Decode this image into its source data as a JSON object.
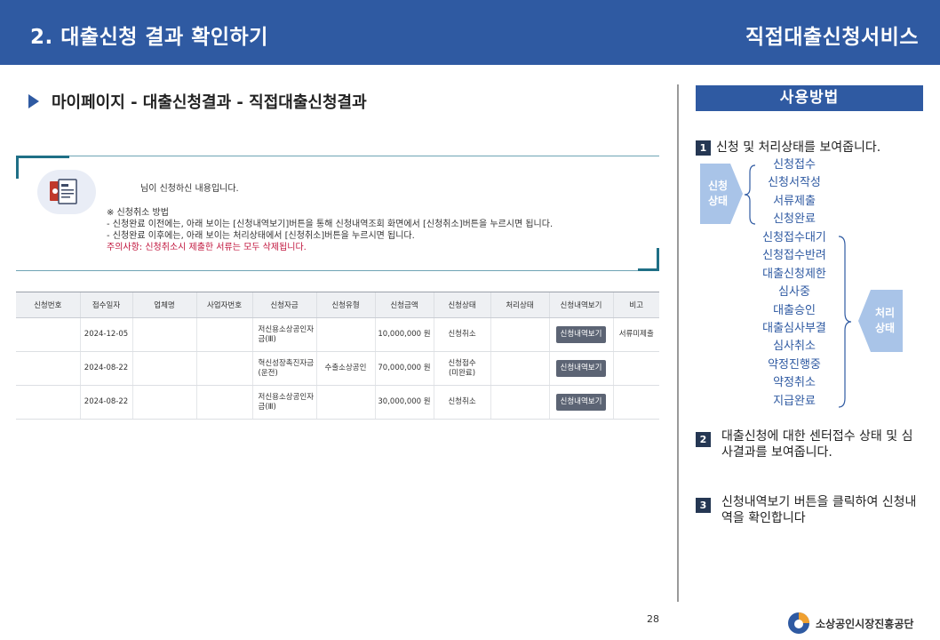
{
  "header": {
    "title_left": "2. 대출신청 결과 확인하기",
    "title_right": "직접대출신청서비스"
  },
  "breadcrumb": "마이페이지 - 대출신청결과 - 직접대출신청결과",
  "notice": {
    "greeting": "님이 신청하신 내용입니다.",
    "lines": [
      "※ 신청취소 방법",
      "- 신청완료 이전에는, 아래 보이는 [신청내역보기]버튼을 통해 신청내역조회 화면에서 [신청취소]버튼을 누르시면 됩니다.",
      "- 신청완료 이후에는, 아래 보이는 처리상태에서 [신청취소]버튼을 누르시면 됩니다."
    ],
    "warning": "주의사항: 신청취소시 제출한 서류는 모두 삭제됩니다."
  },
  "table": {
    "headers": [
      "신청번호",
      "접수일자",
      "업체명",
      "사업자번호",
      "신청자금",
      "신청유형",
      "신청금액",
      "신청상태",
      "처리상태",
      "신청내역보기",
      "비고"
    ],
    "rows": [
      {
        "date": "2024-12-05",
        "fund": "저신용소상공인자금(Ⅲ)",
        "type": "",
        "amount": "10,000,000 원",
        "status": "신청취소",
        "button": "신청내역보기",
        "note": "서류미제출"
      },
      {
        "date": "2024-08-22",
        "fund": "혁신성장촉진자금(운전)",
        "type": "수출소상공인",
        "amount": "70,000,000 원",
        "status": "신청접수\n(미완료)",
        "button": "신청내역보기",
        "note": ""
      },
      {
        "date": "2024-08-22",
        "fund": "저신용소상공인자금(Ⅲ)",
        "type": "",
        "amount": "30,000,000 원",
        "status": "신청취소",
        "button": "신청내역보기",
        "note": ""
      }
    ]
  },
  "page_number": "28",
  "org_name": "소상공인시장진흥공단",
  "usage": {
    "title": "사용방법",
    "steps": [
      {
        "num": "1",
        "text": "신청 및 처리상태를 보여줍니다."
      },
      {
        "num": "2",
        "text": "대출신청에 대한 센터접수 상태 및 심사결과를 보여줍니다."
      },
      {
        "num": "3",
        "text": "신청내역보기 버튼을 클릭하여 신청내역을 확인합니다"
      }
    ],
    "apply_state": {
      "label": "신청\n상태",
      "items": [
        "신청접수",
        "신청서작성",
        "서류제출",
        "신청완료"
      ]
    },
    "process_state": {
      "label": "처리\n상태",
      "items": [
        "신청접수대기",
        "신청접수반려",
        "대출신청제한",
        "심사중",
        "대출승인",
        "대출심사부결",
        "심사취소",
        "약정진행중",
        "약정취소",
        "지급완료"
      ]
    }
  },
  "colors": {
    "header_bg": "#2f5aa2",
    "accent_teal": "#1f6f86",
    "warning": "#c0143c",
    "state_tag": "#a9c4e8",
    "button_bg": "#5c6474"
  }
}
